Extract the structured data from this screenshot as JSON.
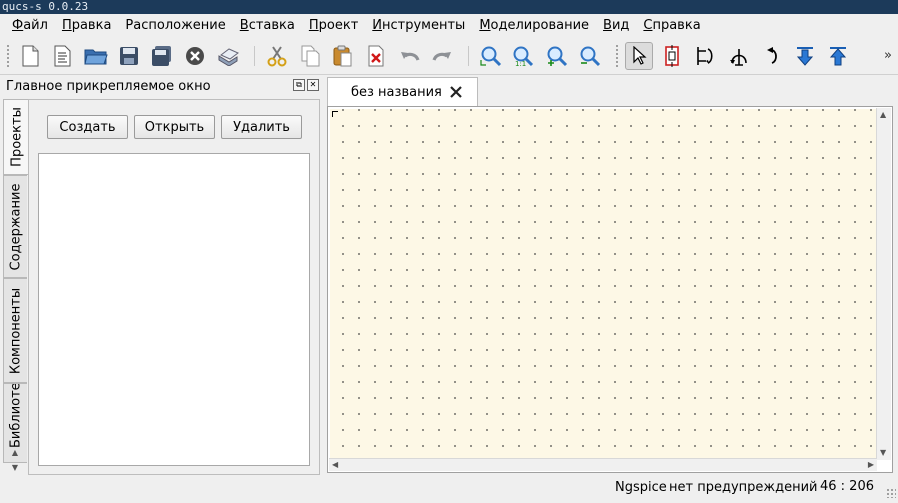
{
  "window": {
    "title": "qucs-s 0.0.23"
  },
  "menubar": [
    {
      "ul": "Ф",
      "rest": "айл"
    },
    {
      "ul": "П",
      "rest": "равка"
    },
    {
      "ul": "Р",
      "rest": "асположение"
    },
    {
      "ul": "В",
      "rest": "ставка"
    },
    {
      "ul": "П",
      "rest": "роект"
    },
    {
      "ul": "И",
      "rest": "нструменты"
    },
    {
      "ul": "М",
      "rest": "оделирование"
    },
    {
      "ul": "В",
      "rest": "ид"
    },
    {
      "ul": "С",
      "rest": "правка"
    }
  ],
  "toolbar": {
    "overflow": "»"
  },
  "dock": {
    "title": "Главное прикрепляемое окно",
    "tabs": [
      "Проекты",
      "Содержание",
      "Компоненты",
      "Библиотеки"
    ],
    "buttons": {
      "create": "Создать",
      "open": "Открыть",
      "delete": "Удалить"
    }
  },
  "document": {
    "tab_label": "без названия"
  },
  "statusbar": {
    "simulator": "Ngspice",
    "warnings": "нет предупреждений",
    "coords": "46 : 206"
  },
  "colors": {
    "canvas_bg": "#fdf8e6",
    "titlebar_bg": "#1c3a5a",
    "window_bg": "#efefef"
  }
}
